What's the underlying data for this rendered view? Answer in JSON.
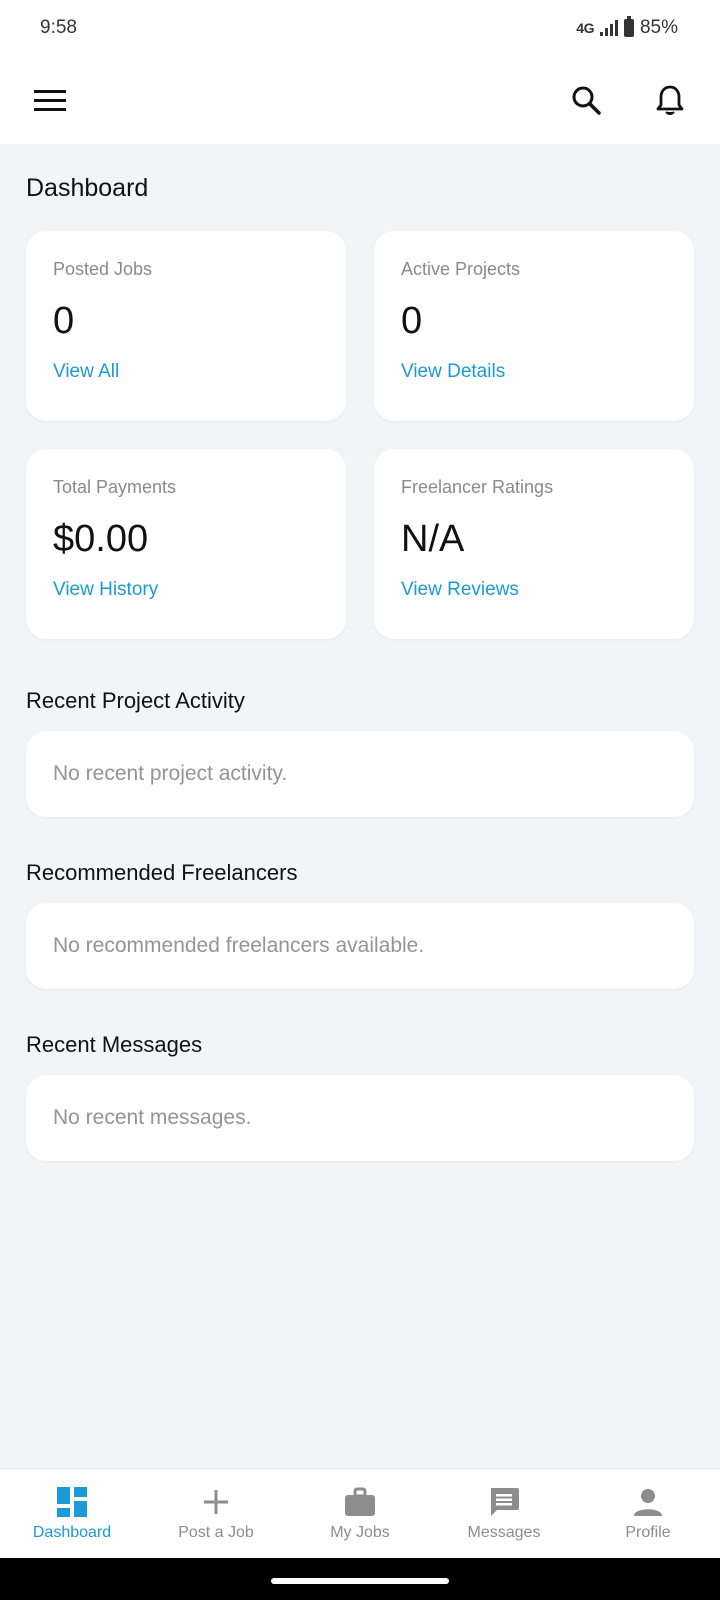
{
  "status": {
    "time": "9:58",
    "network": "4G",
    "battery": "85%"
  },
  "app_bar": {
    "menu_icon": "hamburger-menu-icon",
    "search_icon": "search-icon",
    "notification_icon": "bell-icon"
  },
  "dashboard": {
    "title": "Dashboard",
    "stats": [
      {
        "label": "Posted Jobs",
        "value": "0",
        "link": "View All"
      },
      {
        "label": "Active Projects",
        "value": "0",
        "link": "View Details"
      },
      {
        "label": "Total Payments",
        "value": "$0.00",
        "link": "View History"
      },
      {
        "label": "Freelancer Ratings",
        "value": "N/A",
        "link": "View Reviews"
      }
    ],
    "sections": [
      {
        "title": "Recent Project Activity",
        "empty": "No recent project activity."
      },
      {
        "title": "Recommended Freelancers",
        "empty": "No recommended freelancers available."
      },
      {
        "title": "Recent Messages",
        "empty": "No recent messages."
      }
    ]
  },
  "bottom_nav": {
    "items": [
      {
        "label": "Dashboard",
        "icon": "dashboard-icon",
        "active": true
      },
      {
        "label": "Post a Job",
        "icon": "plus-icon",
        "active": false
      },
      {
        "label": "My Jobs",
        "icon": "briefcase-icon",
        "active": false
      },
      {
        "label": "Messages",
        "icon": "message-icon",
        "active": false
      },
      {
        "label": "Profile",
        "icon": "person-icon",
        "active": false
      }
    ]
  },
  "colors": {
    "accent": "#1a9ad6",
    "background": "#f2f4f8",
    "card": "#ffffff",
    "muted_text": "#8a8a8a"
  }
}
